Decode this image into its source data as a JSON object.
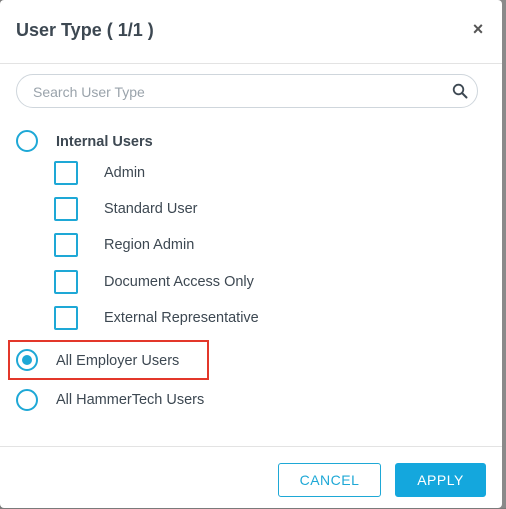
{
  "dialog": {
    "title": "User Type ( 1/1 )",
    "close_glyph": "×"
  },
  "search": {
    "placeholder": "Search User Type",
    "icon": "search-icon"
  },
  "options": {
    "internal": {
      "label": "Internal Users",
      "selected": false,
      "sub_items": [
        {
          "label": "Admin",
          "checked": false
        },
        {
          "label": "Standard User",
          "checked": false
        },
        {
          "label": "Region Admin",
          "checked": false
        },
        {
          "label": "Document Access Only",
          "checked": false
        },
        {
          "label": "External Representative",
          "checked": false
        }
      ]
    },
    "employer": {
      "label": "All Employer Users",
      "selected": true
    },
    "hammertech": {
      "label": "All HammerTech Users",
      "selected": false
    }
  },
  "footer": {
    "cancel_label": "CANCEL",
    "apply_label": "APPLY"
  },
  "colors": {
    "accent": "#1ea8d6",
    "apply_bg": "#14a7dd",
    "highlight": "#e3372a",
    "text": "#3d4852"
  }
}
